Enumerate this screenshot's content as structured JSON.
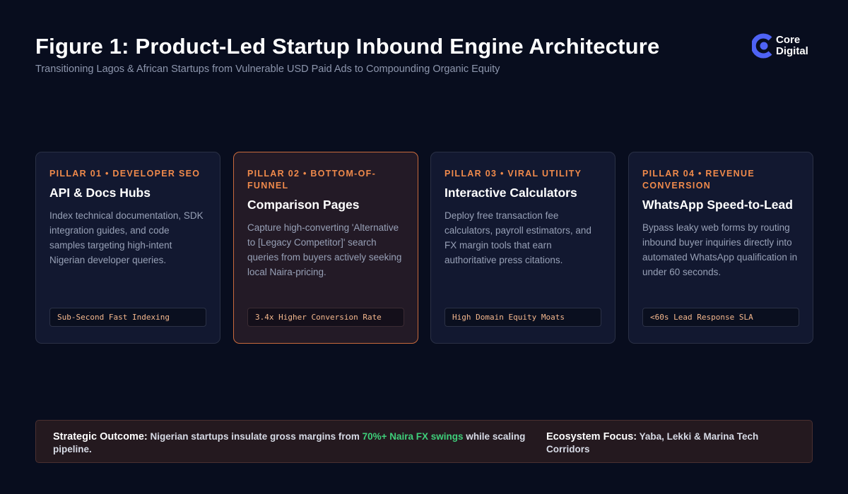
{
  "header": {
    "title": "Figure 1: Product-Led Startup Inbound Engine Architecture",
    "subtitle": "Transitioning Lagos & African Startups from Vulnerable USD Paid Ads to Compounding Organic Equity"
  },
  "logo": {
    "line1": "Core",
    "line2": "Digital",
    "icon": "core-digital-logo-icon",
    "color": "#4f63f5"
  },
  "pillars": [
    {
      "tag": "PILLAR 01 • DEVELOPER SEO",
      "title": "API & Docs Hubs",
      "description": "Index technical documentation, SDK integration guides, and code samples targeting high-intent Nigerian developer queries.",
      "badge": "Sub-Second Fast Indexing",
      "highlighted": false
    },
    {
      "tag": "PILLAR 02 • BOTTOM-OF-FUNNEL",
      "title": "Comparison Pages",
      "description": "Capture high-converting 'Alternative to [Legacy Competitor]' search queries from buyers actively seeking local Naira-pricing.",
      "badge": "3.4x Higher Conversion Rate",
      "highlighted": true
    },
    {
      "tag": "PILLAR 03 • VIRAL UTILITY",
      "title": "Interactive Calculators",
      "description": "Deploy free transaction fee calculators, payroll estimators, and FX margin tools that earn authoritative press citations.",
      "badge": "High Domain Equity Moats",
      "highlighted": false
    },
    {
      "tag": "PILLAR 04 • REVENUE CONVERSION",
      "title": "WhatsApp Speed-to-Lead",
      "description": "Bypass leaky web forms by routing inbound buyer inquiries directly into automated WhatsApp qualification in under 60 seconds.",
      "badge": "<60s Lead Response SLA",
      "highlighted": false
    }
  ],
  "outcome": {
    "label": "Strategic Outcome:",
    "text_before": "Nigerian startups insulate gross margins from",
    "highlight": "70%+ Naira FX swings",
    "text_after": "while scaling pipeline."
  },
  "ecosystem": {
    "label": "Ecosystem Focus:",
    "text": "Yaba, Lekki & Marina Tech Corridors"
  },
  "colors": {
    "background": "#080d1e",
    "accent_orange": "#f08a4b",
    "accent_green": "#3ecf7a",
    "brand_blue": "#4f63f5"
  }
}
